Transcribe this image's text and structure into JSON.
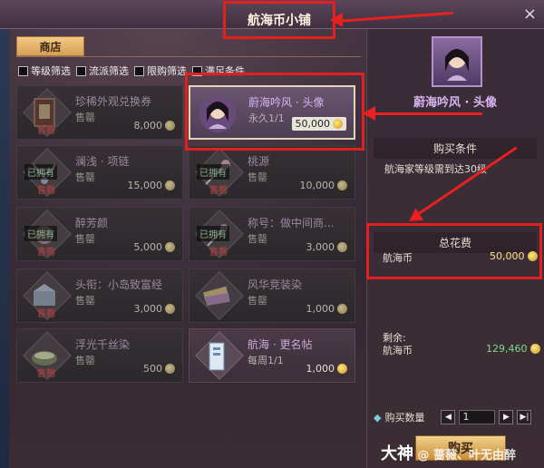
{
  "window": {
    "title": "航海币小铺",
    "close_label": "×"
  },
  "tabs": [
    {
      "label": "商店"
    }
  ],
  "filters": [
    {
      "label": "等级筛选"
    },
    {
      "label": "流派筛选"
    },
    {
      "label": "限购筛选"
    },
    {
      "label": "满足条件"
    }
  ],
  "items": [
    {
      "name": "珍稀外观兑换券",
      "sub": "售罄",
      "price": "8,000",
      "status": "售罄",
      "owned": ""
    },
    {
      "name": "蔚海吟风 · 头像",
      "sub": "永久1/1",
      "price": "50,000",
      "status": "",
      "owned": ""
    },
    {
      "name": "澜浅 · 项链",
      "sub": "售罄",
      "price": "15,000",
      "status": "售罄",
      "owned": "已拥有"
    },
    {
      "name": "桃源",
      "sub": "售罄",
      "price": "10,000",
      "status": "售罄",
      "owned": "已拥有"
    },
    {
      "name": "醉芳颜",
      "sub": "售罄",
      "price": "5,000",
      "status": "售罄",
      "owned": "已拥有"
    },
    {
      "name": "称号：做中间商...",
      "sub": "售罄",
      "price": "3,000",
      "status": "售罄",
      "owned": "已拥有"
    },
    {
      "name": "头衔：小岛致富经",
      "sub": "售罄",
      "price": "3,000",
      "status": "售罄",
      "owned": ""
    },
    {
      "name": "风华竞装染",
      "sub": "售罄",
      "price": "1,000",
      "status": "售罄",
      "owned": ""
    },
    {
      "name": "浮光千丝染",
      "sub": "售罄",
      "price": "500",
      "status": "售罄",
      "owned": ""
    },
    {
      "name": "航海 · 更名帖",
      "sub": "每周1/1",
      "price": "1,000",
      "status": "",
      "owned": ""
    }
  ],
  "detail": {
    "title": "蔚海吟风 · 头像",
    "condition_header": "购买条件",
    "condition_text": "航海家等级需到达30级",
    "total_header": "总花费",
    "currency_label": "航海币",
    "total_value": "50,000",
    "remaining_label": "剩余:",
    "remaining_currency": "航海币",
    "remaining_value": "129,460",
    "qty_label": "购买数量",
    "qty_value": "1",
    "buy_label": "购买"
  },
  "watermark": {
    "brand": "大神",
    "text": "@ 蔷薇、叶无由醉"
  },
  "colors": {
    "highlight_red": "#e32020",
    "accent_purple": "#d8b4f0",
    "remaining_green": "#7fd88a",
    "button_gold": "#f2d08a"
  }
}
